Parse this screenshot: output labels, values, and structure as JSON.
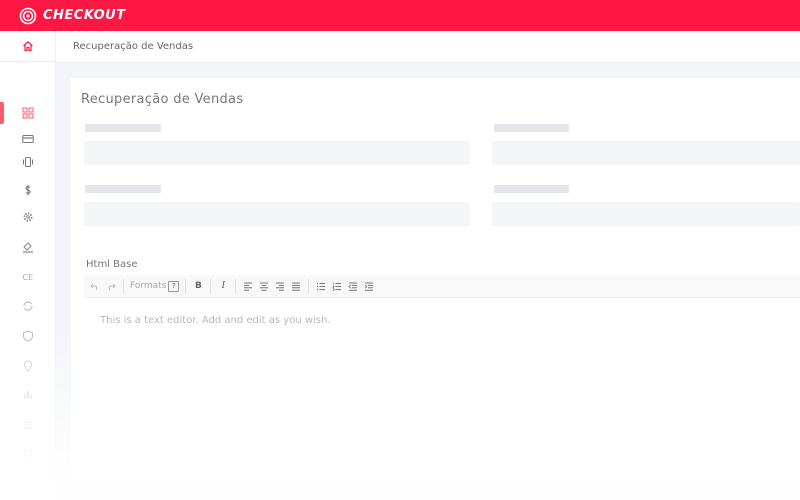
{
  "brand": {
    "name": "CHECKOUT"
  },
  "colors": {
    "accent": "#ff1744",
    "active": "#ff5a6e",
    "icon": "#8a8a8a"
  },
  "sidebar": {
    "home_icon": "home-icon",
    "items": [
      {
        "icon": "dashboard-grid-icon",
        "active": true
      },
      {
        "icon": "credit-card-icon",
        "active": false
      },
      {
        "icon": "vibrate-icon",
        "active": false
      },
      {
        "icon": "dollar-icon",
        "active": false
      },
      {
        "icon": "settings-gear-icon",
        "active": false
      },
      {
        "icon": "paint-bucket-icon",
        "active": false
      },
      {
        "icon": "ce-icon",
        "active": false
      },
      {
        "icon": "sync-icon",
        "active": false
      },
      {
        "icon": "shield-icon",
        "active": false
      },
      {
        "icon": "location-pin-icon",
        "active": false
      },
      {
        "icon": "bar-chart-icon",
        "active": false
      },
      {
        "icon": "list-icon",
        "active": false
      },
      {
        "icon": "more-icon",
        "active": false
      }
    ]
  },
  "breadcrumb": {
    "current": "Recuperação de Vendas"
  },
  "page": {
    "title": "Recuperação de Vendas"
  },
  "editor": {
    "label": "Html Base",
    "formats_label": "Formats",
    "help_label": "?",
    "bold_label": "B",
    "italic_label": "I",
    "content": "This is a text editor.  Add and edit as you wish."
  }
}
